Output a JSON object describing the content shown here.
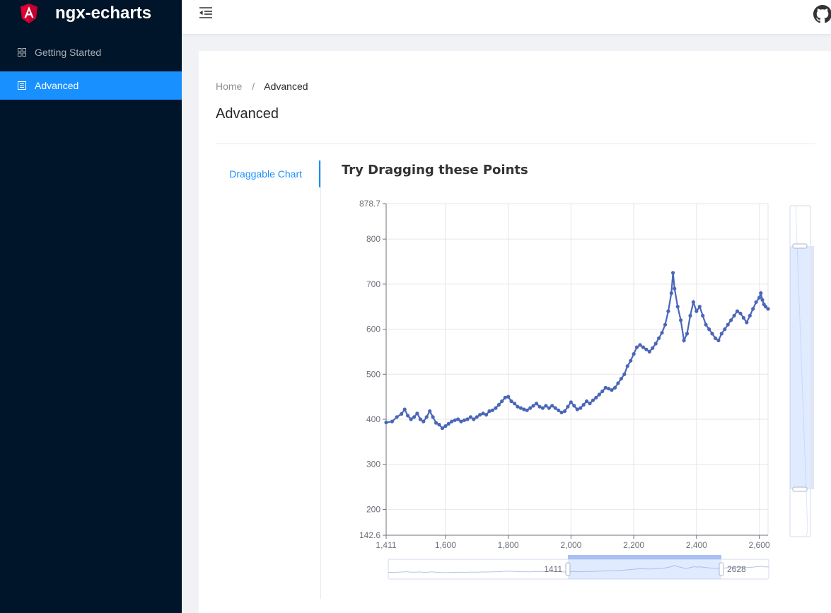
{
  "app": {
    "title": "ngx-echarts"
  },
  "sidebar": {
    "items": [
      {
        "label": "Getting Started",
        "icon": "appstore-icon",
        "active": false
      },
      {
        "label": "Advanced",
        "icon": "layout-icon",
        "active": true
      }
    ]
  },
  "header": {
    "fold_icon": "menu-fold-icon",
    "github_icon": "github-icon"
  },
  "breadcrumb": {
    "home": "Home",
    "separator": "/",
    "current": "Advanced"
  },
  "page": {
    "title": "Advanced"
  },
  "tabs": [
    {
      "label": "Draggable Chart",
      "active": true
    }
  ],
  "colors": {
    "accent": "#1890ff",
    "sidebar": "#001529",
    "series": "#4a66b8"
  },
  "chart_data": {
    "type": "line",
    "title": "Try Dragging these Points",
    "x_ticks": [
      "1,411",
      "1,600",
      "1,800",
      "2,000",
      "2,200",
      "2,400",
      "2,600"
    ],
    "y_ticks": [
      "142.6",
      "200",
      "300",
      "400",
      "500",
      "600",
      "700",
      "800",
      "878.7"
    ],
    "xlim": [
      1411,
      2628
    ],
    "ylim": [
      142.6,
      878.7
    ],
    "grid": true,
    "datazoom_x": {
      "start": 1411,
      "end": 2628
    },
    "series": [
      {
        "values": [
          [
            1411,
            393
          ],
          [
            1430,
            395
          ],
          [
            1445,
            405
          ],
          [
            1460,
            412
          ],
          [
            1470,
            422
          ],
          [
            1480,
            408
          ],
          [
            1490,
            400
          ],
          [
            1500,
            405
          ],
          [
            1510,
            413
          ],
          [
            1520,
            400
          ],
          [
            1530,
            395
          ],
          [
            1540,
            405
          ],
          [
            1550,
            418
          ],
          [
            1560,
            405
          ],
          [
            1570,
            392
          ],
          [
            1580,
            388
          ],
          [
            1590,
            380
          ],
          [
            1600,
            385
          ],
          [
            1610,
            390
          ],
          [
            1620,
            395
          ],
          [
            1630,
            398
          ],
          [
            1640,
            400
          ],
          [
            1650,
            395
          ],
          [
            1660,
            398
          ],
          [
            1670,
            400
          ],
          [
            1680,
            405
          ],
          [
            1690,
            400
          ],
          [
            1700,
            405
          ],
          [
            1710,
            410
          ],
          [
            1720,
            413
          ],
          [
            1730,
            410
          ],
          [
            1740,
            418
          ],
          [
            1750,
            420
          ],
          [
            1760,
            425
          ],
          [
            1770,
            432
          ],
          [
            1780,
            440
          ],
          [
            1790,
            448
          ],
          [
            1800,
            450
          ],
          [
            1810,
            440
          ],
          [
            1820,
            435
          ],
          [
            1830,
            428
          ],
          [
            1840,
            425
          ],
          [
            1850,
            422
          ],
          [
            1860,
            420
          ],
          [
            1870,
            425
          ],
          [
            1880,
            430
          ],
          [
            1890,
            435
          ],
          [
            1900,
            428
          ],
          [
            1910,
            425
          ],
          [
            1920,
            430
          ],
          [
            1930,
            425
          ],
          [
            1940,
            430
          ],
          [
            1950,
            425
          ],
          [
            1960,
            420
          ],
          [
            1970,
            415
          ],
          [
            1980,
            418
          ],
          [
            1990,
            428
          ],
          [
            2000,
            438
          ],
          [
            2010,
            430
          ],
          [
            2020,
            422
          ],
          [
            2030,
            425
          ],
          [
            2040,
            432
          ],
          [
            2050,
            440
          ],
          [
            2060,
            435
          ],
          [
            2070,
            442
          ],
          [
            2080,
            448
          ],
          [
            2090,
            455
          ],
          [
            2100,
            462
          ],
          [
            2110,
            470
          ],
          [
            2120,
            468
          ],
          [
            2130,
            465
          ],
          [
            2140,
            470
          ],
          [
            2150,
            480
          ],
          [
            2160,
            490
          ],
          [
            2170,
            500
          ],
          [
            2180,
            518
          ],
          [
            2190,
            530
          ],
          [
            2200,
            545
          ],
          [
            2210,
            560
          ],
          [
            2220,
            565
          ],
          [
            2230,
            560
          ],
          [
            2240,
            555
          ],
          [
            2250,
            550
          ],
          [
            2260,
            558
          ],
          [
            2270,
            568
          ],
          [
            2280,
            580
          ],
          [
            2290,
            592
          ],
          [
            2300,
            610
          ],
          [
            2310,
            640
          ],
          [
            2320,
            680
          ],
          [
            2325,
            725
          ],
          [
            2330,
            690
          ],
          [
            2340,
            650
          ],
          [
            2350,
            620
          ],
          [
            2360,
            575
          ],
          [
            2370,
            590
          ],
          [
            2380,
            630
          ],
          [
            2390,
            660
          ],
          [
            2400,
            640
          ],
          [
            2410,
            650
          ],
          [
            2420,
            630
          ],
          [
            2430,
            610
          ],
          [
            2440,
            600
          ],
          [
            2450,
            590
          ],
          [
            2460,
            580
          ],
          [
            2470,
            575
          ],
          [
            2480,
            590
          ],
          [
            2490,
            600
          ],
          [
            2500,
            610
          ],
          [
            2510,
            620
          ],
          [
            2520,
            630
          ],
          [
            2530,
            640
          ],
          [
            2540,
            635
          ],
          [
            2550,
            625
          ],
          [
            2560,
            615
          ],
          [
            2570,
            630
          ],
          [
            2580,
            645
          ],
          [
            2590,
            660
          ],
          [
            2600,
            670
          ],
          [
            2605,
            680
          ],
          [
            2610,
            665
          ],
          [
            2615,
            655
          ],
          [
            2620,
            650
          ],
          [
            2628,
            645
          ]
        ]
      }
    ]
  }
}
